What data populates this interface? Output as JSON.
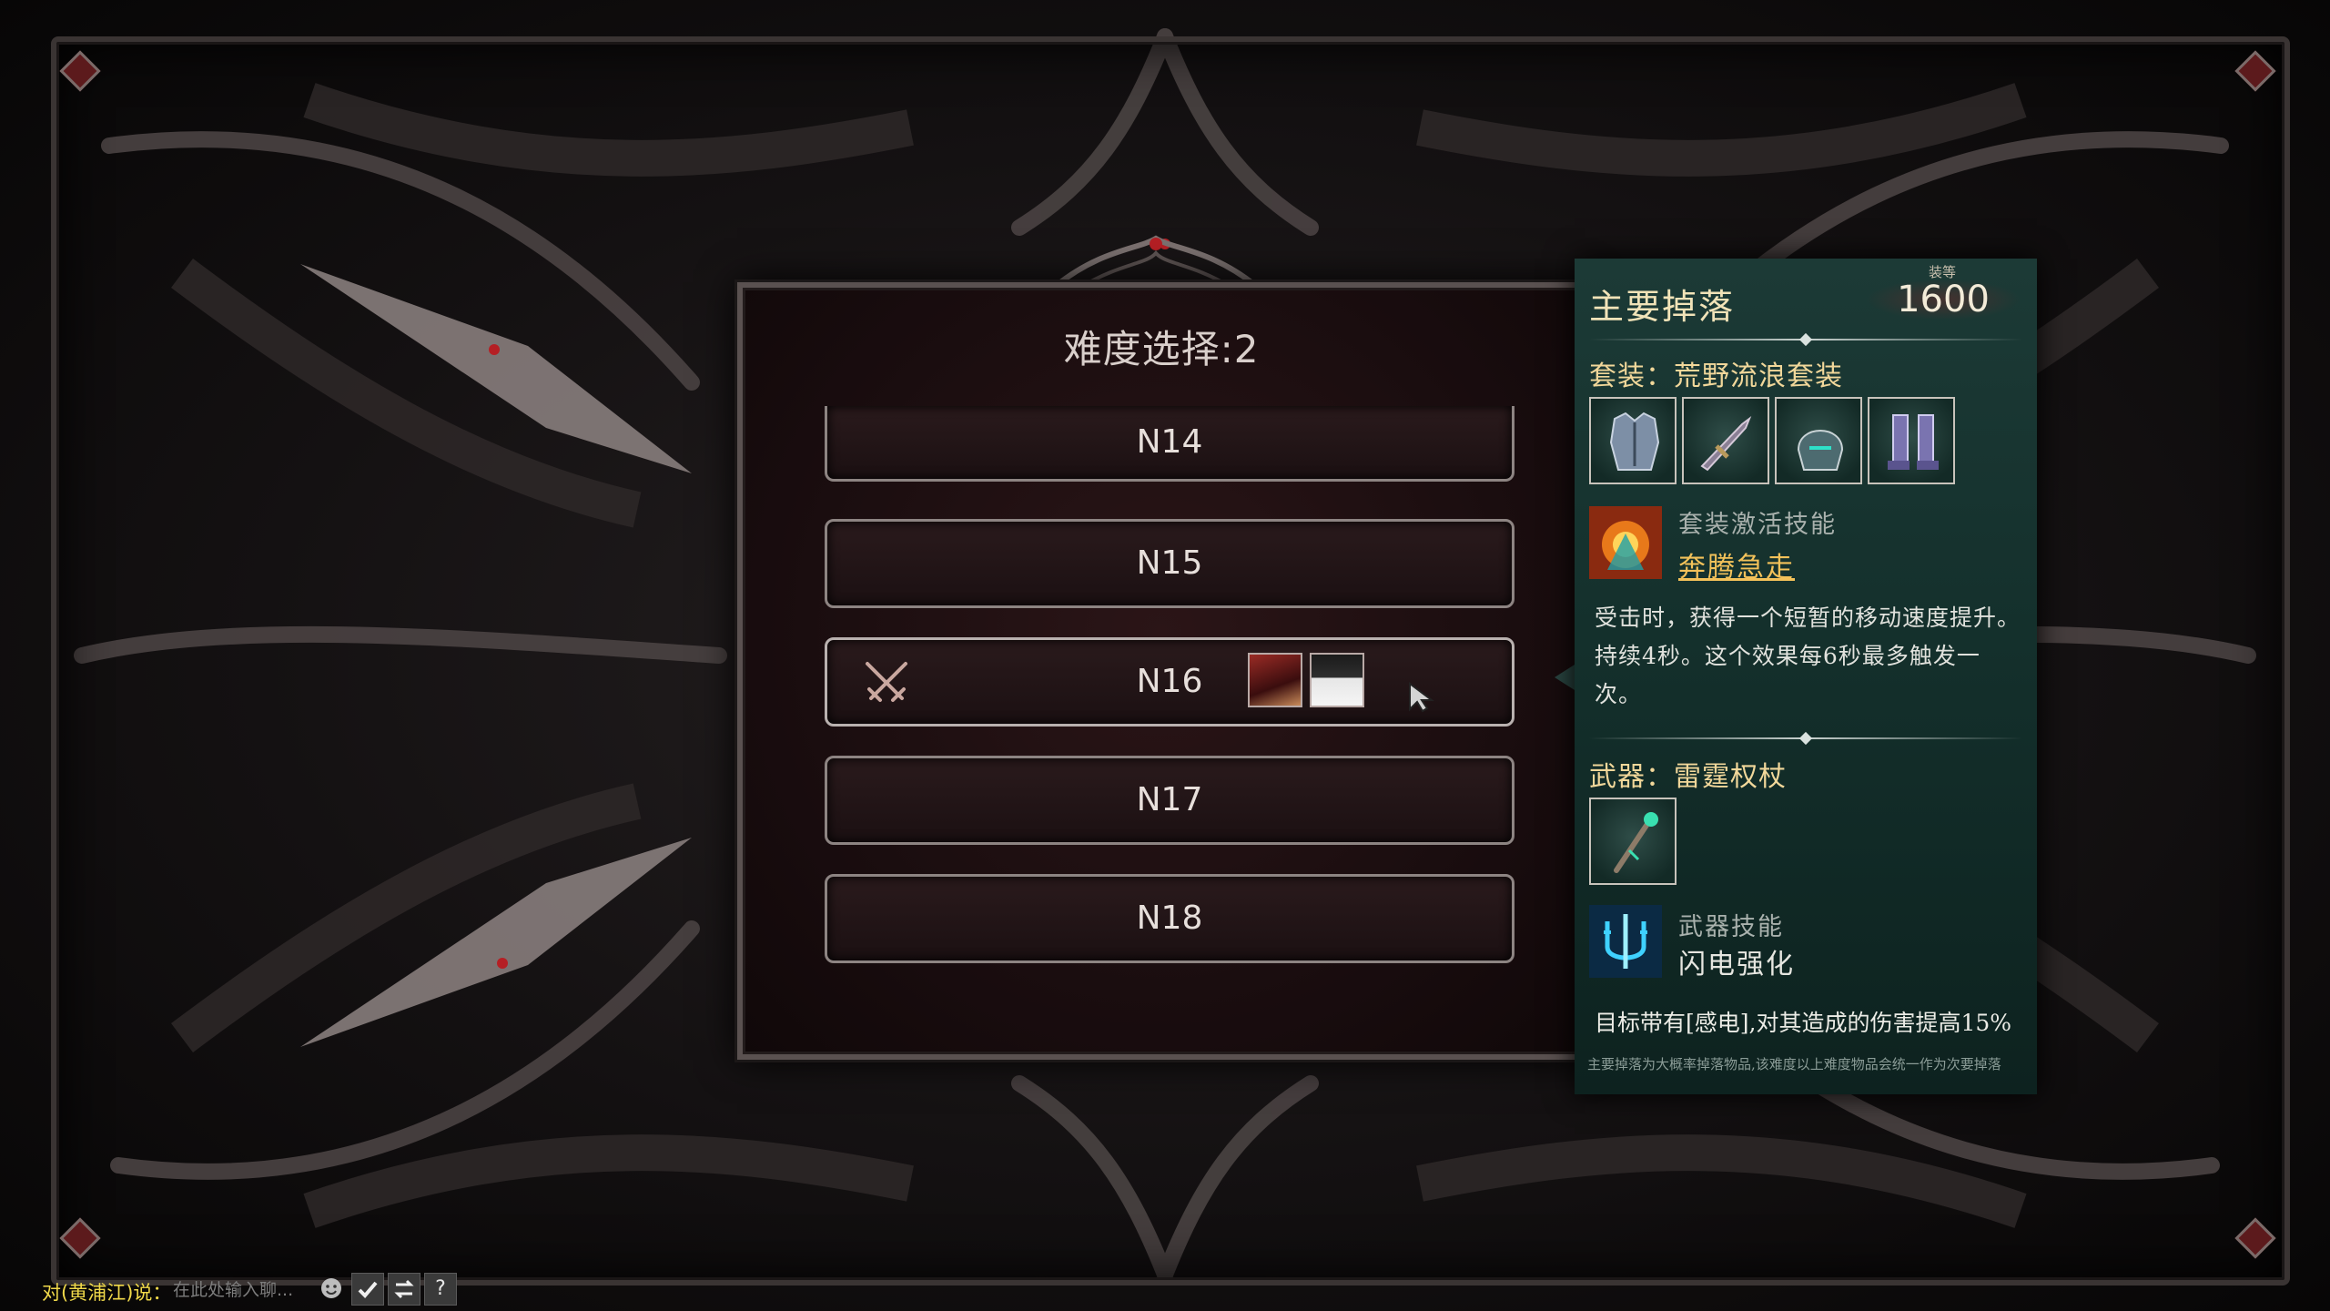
{
  "difficulty_panel": {
    "title": "难度选择:2",
    "levels": [
      {
        "label": "N14"
      },
      {
        "label": "N15"
      },
      {
        "label": "N16"
      },
      {
        "label": "N17"
      },
      {
        "label": "N18"
      }
    ]
  },
  "drop_panel": {
    "title": "主要掉落",
    "level_caption": "装等",
    "level_value": "1600",
    "set_title": "套装：荒野流浪套装",
    "set_slots": [
      "chest-armor-icon",
      "dagger-icon",
      "helmet-icon",
      "greaves-icon"
    ],
    "set_skill_caption": "套装激活技能",
    "set_skill_name": "奔腾急走",
    "set_skill_desc": "受击时，获得一个短暂的移动速度提升。持续4秒。这个效果每6秒最多触发一次。",
    "weapon_title": "武器：雷霆权杖",
    "weapon_skill_caption": "武器技能",
    "weapon_skill_name": "闪电强化",
    "weapon_skill_desc": "目标带有[感电],对其造成的伤害提高15%",
    "footnote": "主要掉落为大概率掉落物品,该难度以上难度物品会统一作为次要掉落"
  },
  "chat": {
    "prefix": "对(黄浦江)说：",
    "placeholder": "在此处输入聊...",
    "help_label": "?"
  }
}
